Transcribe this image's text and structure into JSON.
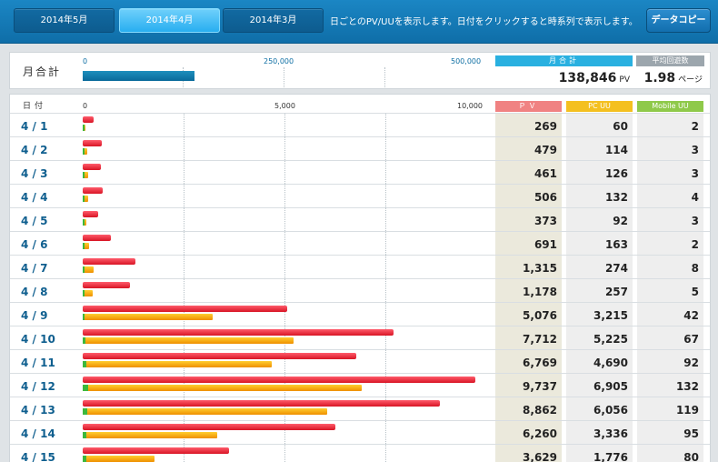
{
  "tabs": [
    {
      "label": "2014年5月",
      "active": false
    },
    {
      "label": "2014年4月",
      "active": true
    },
    {
      "label": "2014年3月",
      "active": false
    }
  ],
  "header": {
    "message": "日ごとのPV/UUを表示します。日付をクリックすると時系列で表示します。",
    "copy_button": "データコピー"
  },
  "monthly": {
    "label": "月合計",
    "axis_ticks": [
      "0",
      "250,000",
      "500,000"
    ],
    "axis_max": 500000,
    "total_pv": 138846,
    "total_pv_text": "138,846",
    "pv_unit": "PV",
    "sum_header": "月合計",
    "avg_header": "平均回遊数",
    "avg_value": "1.98",
    "avg_unit": "ページ"
  },
  "daily": {
    "date_header": "日付",
    "axis_ticks": [
      "0",
      "5,000",
      "10,000"
    ],
    "axis_max": 10000,
    "col_pv": "ＰＶ",
    "col_pc": "PC UU",
    "col_mobile": "Mobile UU",
    "colors": {
      "pv": "#e8212f",
      "pc": "#f6a800",
      "mobile": "#3cb83c"
    }
  },
  "chart_data": {
    "type": "bar",
    "categories": [
      "4 / 1",
      "4 / 2",
      "4 / 3",
      "4 / 4",
      "4 / 5",
      "4 / 6",
      "4 / 7",
      "4 / 8",
      "4 / 9",
      "4 / 10",
      "4 / 11",
      "4 / 12",
      "4 / 13",
      "4 / 14",
      "4 / 15"
    ],
    "xlim": [
      0,
      10000
    ],
    "series": [
      {
        "name": "ＰＶ",
        "values": [
          269,
          479,
          461,
          506,
          373,
          691,
          1315,
          1178,
          5076,
          7712,
          6769,
          9737,
          8862,
          6260,
          3629
        ]
      },
      {
        "name": "PC UU",
        "values": [
          60,
          114,
          126,
          132,
          92,
          163,
          274,
          257,
          3215,
          5225,
          4690,
          6905,
          6056,
          3336,
          1776
        ]
      },
      {
        "name": "Mobile UU",
        "values": [
          2,
          3,
          3,
          4,
          3,
          2,
          8,
          5,
          42,
          67,
          92,
          132,
          119,
          95,
          80
        ]
      }
    ]
  }
}
